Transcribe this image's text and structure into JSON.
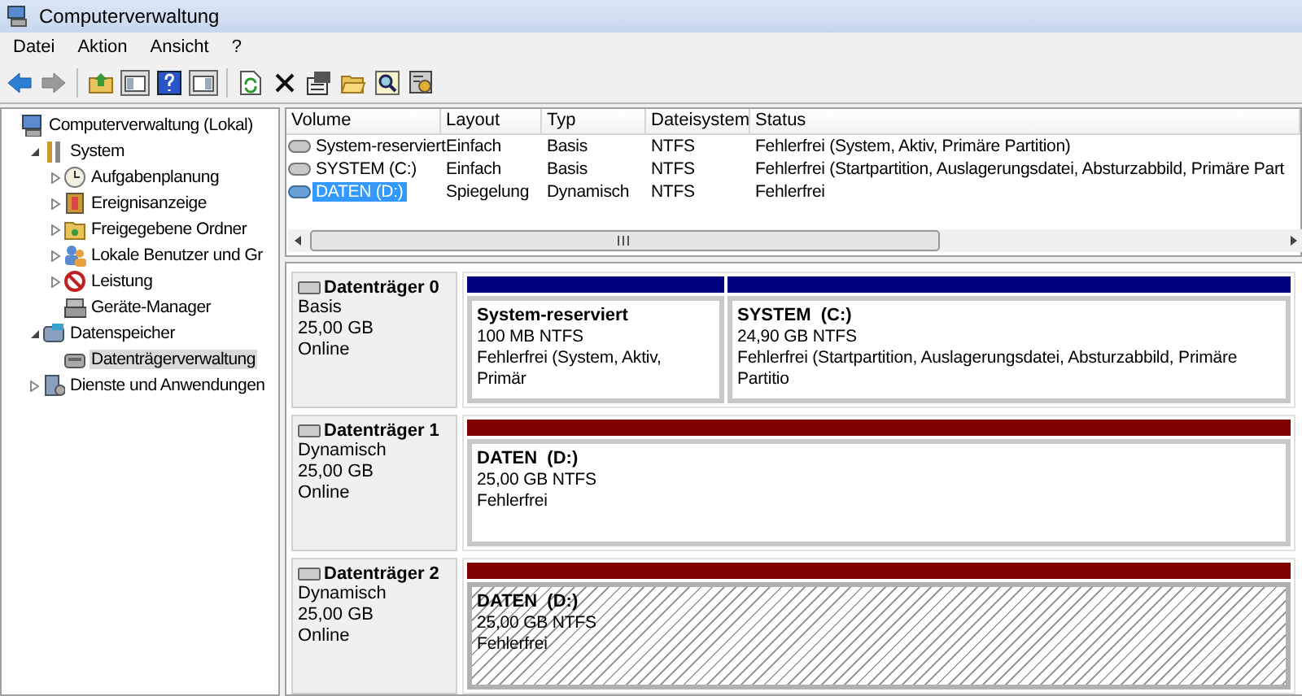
{
  "window": {
    "title": "Computerverwaltung"
  },
  "menu": [
    "Datei",
    "Aktion",
    "Ansicht",
    "?"
  ],
  "toolbar": [
    {
      "kind": "back",
      "disabled": false
    },
    {
      "kind": "forward",
      "disabled": true
    },
    {
      "kind": "separator"
    },
    {
      "kind": "up"
    },
    {
      "kind": "tree"
    },
    {
      "kind": "help"
    },
    {
      "kind": "actionpane"
    },
    {
      "kind": "separator"
    },
    {
      "kind": "refresh"
    },
    {
      "kind": "delete"
    },
    {
      "kind": "properties"
    },
    {
      "kind": "open"
    },
    {
      "kind": "search"
    },
    {
      "kind": "settings"
    }
  ],
  "tree": [
    {
      "label": "Computerverwaltung (Lokal)",
      "kind": "computer",
      "selected": false,
      "children": [
        {
          "label": "System",
          "kind": "tools",
          "expanded": true,
          "selected": false,
          "children": [
            {
              "label": "Aufgabenplanung",
              "kind": "clock",
              "expanded": false,
              "selected": false
            },
            {
              "label": "Ereignisanzeige",
              "kind": "log",
              "expanded": false,
              "selected": false
            },
            {
              "label": "Freigegebene Ordner",
              "kind": "folder",
              "expanded": false,
              "selected": false
            },
            {
              "label": "Lokale Benutzer und Gr",
              "kind": "users",
              "expanded": false,
              "selected": false
            },
            {
              "label": "Leistung",
              "kind": "gauge",
              "expanded": false,
              "selected": false
            },
            {
              "label": "Geräte-Manager",
              "kind": "device",
              "selected": false
            }
          ]
        },
        {
          "label": "Datenspeicher",
          "kind": "storage",
          "expanded": true,
          "selected": false,
          "children": [
            {
              "label": "Datenträgerverwaltung",
              "kind": "disk",
              "selected": true
            }
          ]
        },
        {
          "label": "Dienste und Anwendungen",
          "kind": "services",
          "expanded": false,
          "selected": false
        }
      ]
    }
  ],
  "volumes": {
    "columns": [
      "Volume",
      "Layout",
      "Typ",
      "Dateisystem",
      "Status"
    ],
    "rows": [
      {
        "kind": "basic",
        "selected": false,
        "cells": [
          "System-reserviert",
          "Einfach",
          "Basis",
          "NTFS",
          "Fehlerfrei (System, Aktiv, Primäre Partition)"
        ]
      },
      {
        "kind": "basic",
        "selected": false,
        "cells": [
          "SYSTEM (C:)",
          "Einfach",
          "Basis",
          "NTFS",
          "Fehlerfrei (Startpartition, Auslagerungsdatei, Absturzabbild, Primäre Part"
        ]
      },
      {
        "kind": "dynamic",
        "selected": true,
        "cells": [
          "DATEN (D:)",
          "Spiegelung",
          "Dynamisch",
          "NTFS",
          "Fehlerfrei"
        ]
      }
    ]
  },
  "disks": [
    {
      "name": "Datenträger 0",
      "type": "Basis",
      "size": "25,00 GB",
      "status": "Online",
      "partitions": [
        {
          "kind": "primary",
          "selected": false,
          "name": "System-reserviert",
          "size": "100 MB NTFS",
          "status": "Fehlerfrei (System, Aktiv, Primär"
        },
        {
          "kind": "primary",
          "selected": false,
          "name": "SYSTEM  (C:)",
          "size": "24,90 GB NTFS",
          "status": "Fehlerfrei (Startpartition, Auslagerungsdatei, Absturzabbild, Primäre Partitio"
        }
      ]
    },
    {
      "name": "Datenträger 1",
      "type": "Dynamisch",
      "size": "25,00 GB",
      "status": "Online",
      "partitions": [
        {
          "kind": "mirror",
          "selected": false,
          "name": "DATEN  (D:)",
          "size": "25,00 GB NTFS",
          "status": "Fehlerfrei"
        }
      ]
    },
    {
      "name": "Datenträger 2",
      "type": "Dynamisch",
      "size": "25,00 GB",
      "status": "Online",
      "partitions": [
        {
          "kind": "mirror",
          "selected": true,
          "name": "DATEN  (D:)",
          "size": "25,00 GB NTFS",
          "status": "Fehlerfrei"
        }
      ]
    }
  ]
}
